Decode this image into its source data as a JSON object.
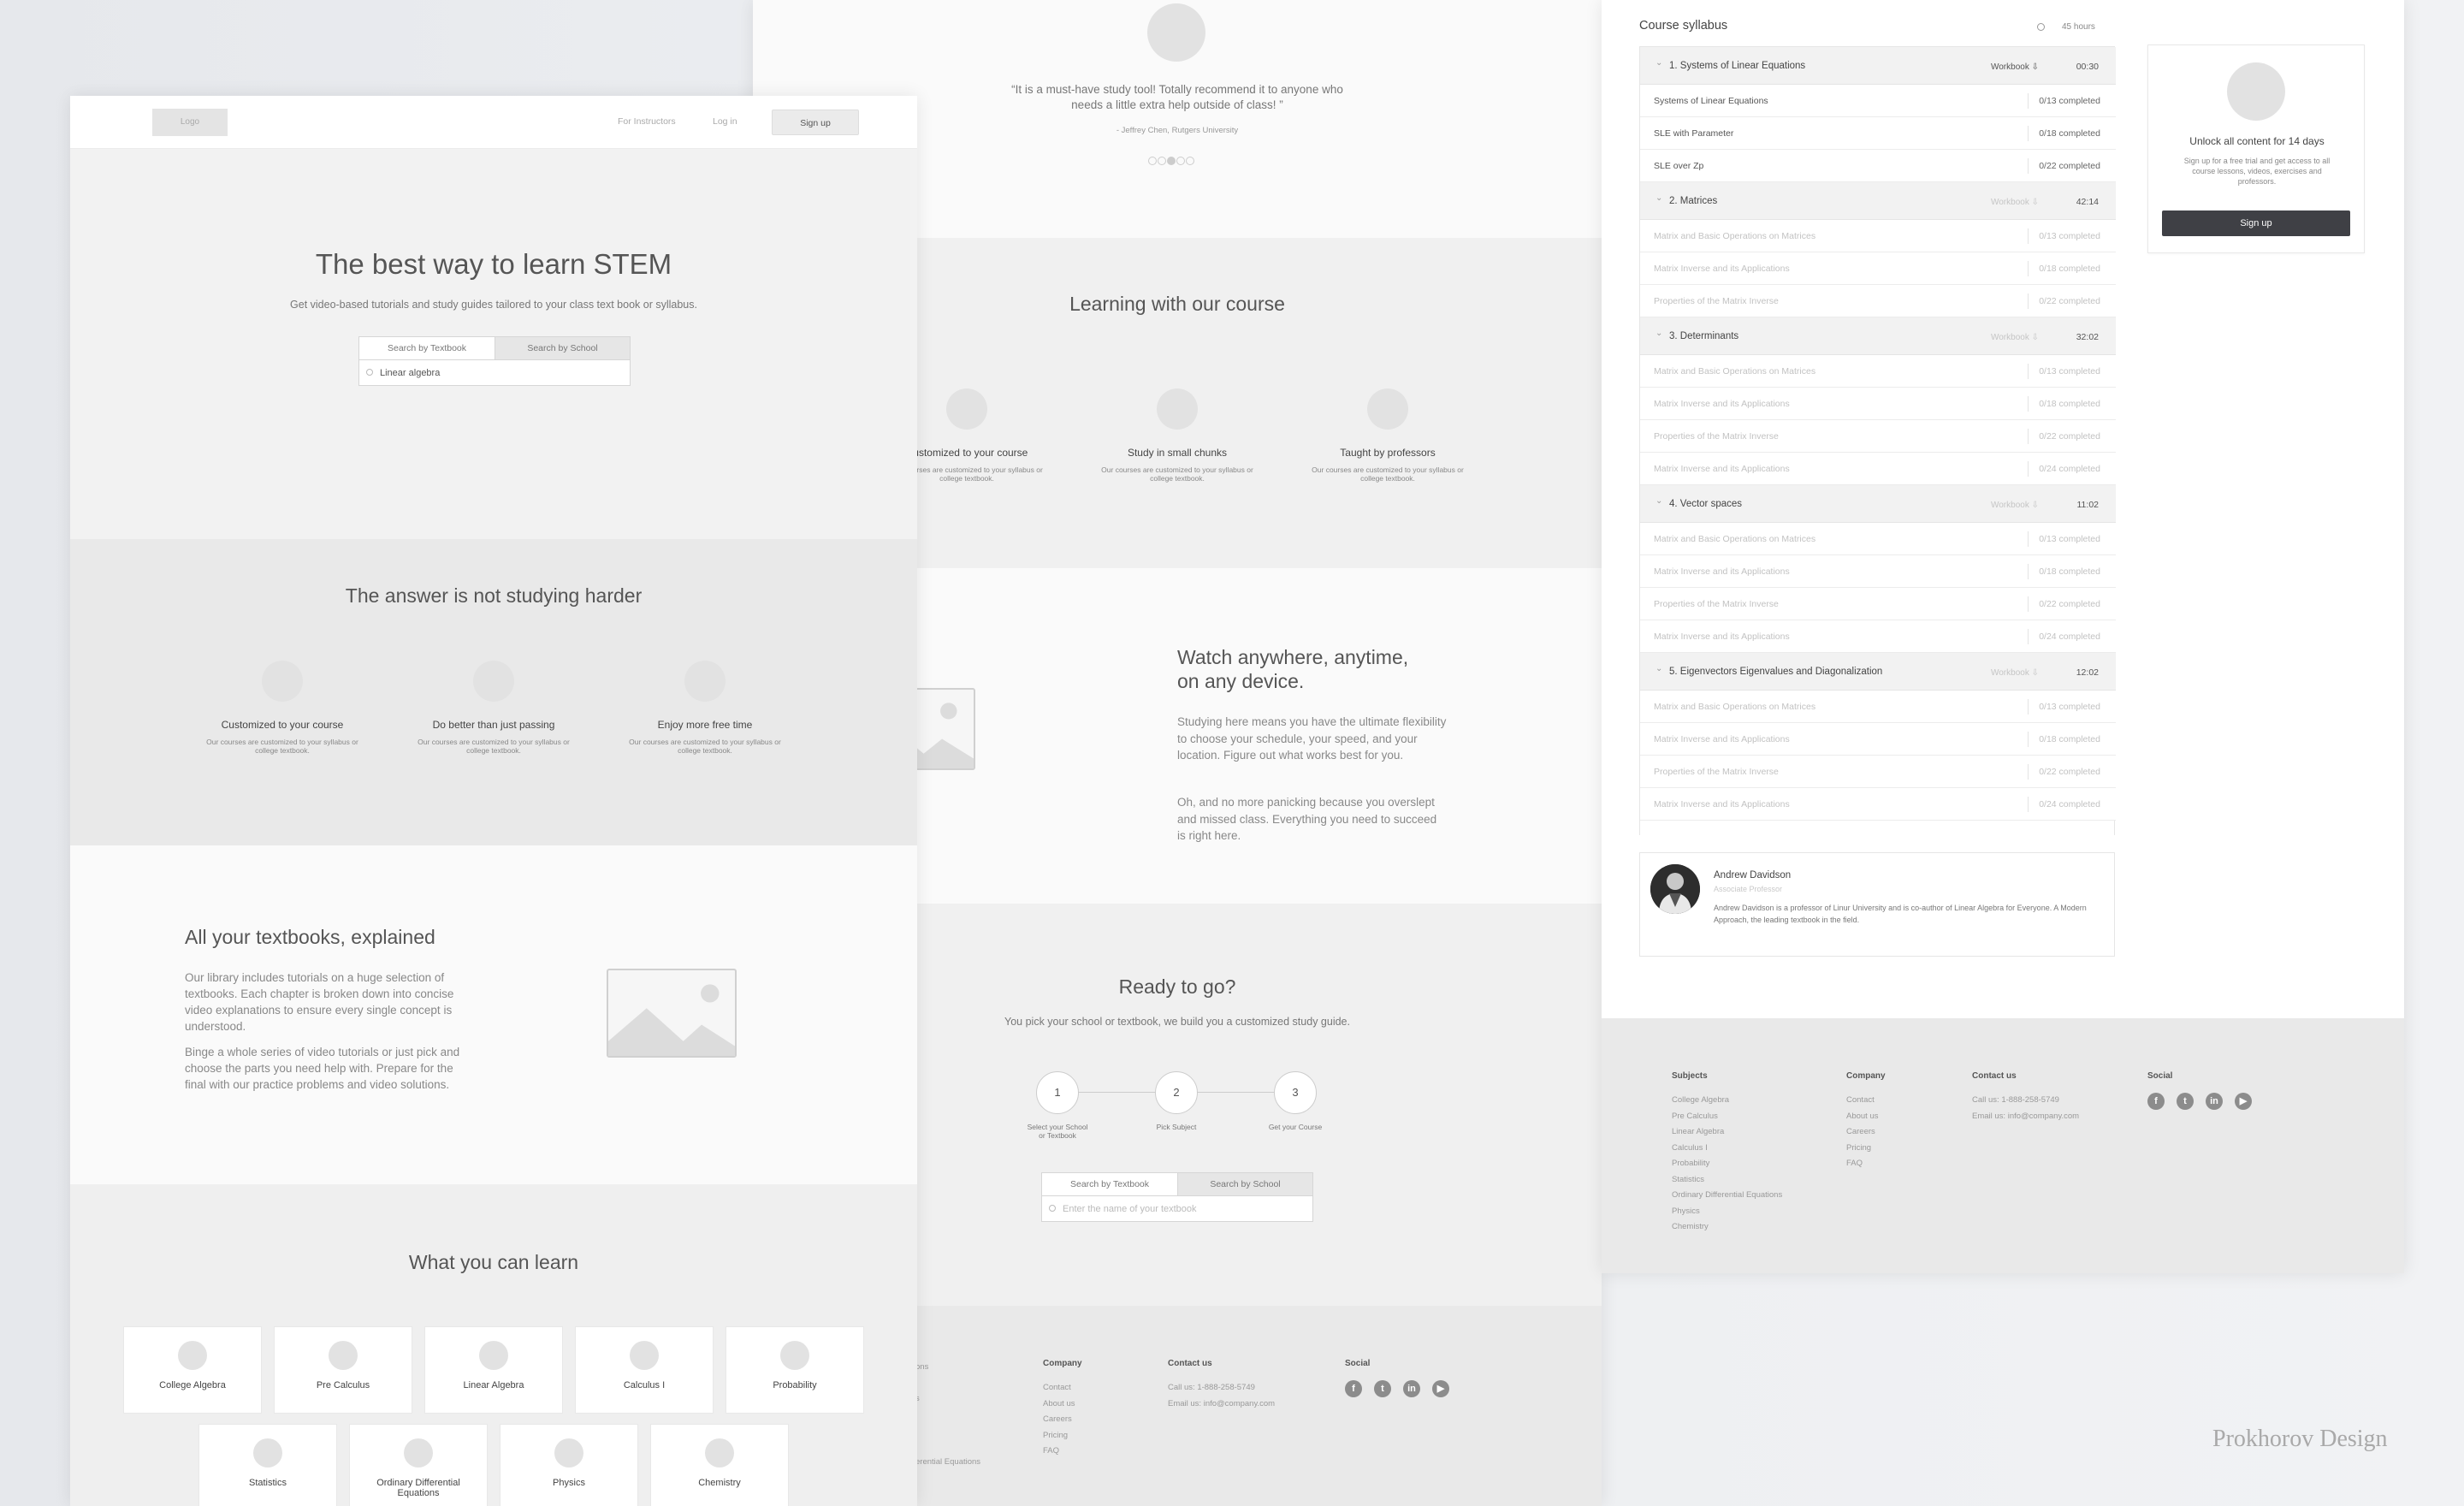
{
  "page1": {
    "nav": {
      "logo": "Logo",
      "for_instructors": "For Instructors",
      "login": "Log in",
      "signup": "Sign up"
    },
    "hero": {
      "title": "The best way to learn STEM",
      "subtitle": "Get video-based tutorials and study guides tailored to your class text book or syllabus.",
      "tab_textbook": "Search by Textbook",
      "tab_school": "Search by School",
      "search_value": "Linear algebra"
    },
    "answer": {
      "title": "The answer is not studying harder",
      "features": [
        {
          "title": "Customized to your course",
          "text": "Our courses are customized to your syllabus or college textbook."
        },
        {
          "title": "Do better than just passing",
          "text": "Our courses are customized to your syllabus or college textbook."
        },
        {
          "title": "Enjoy more free time",
          "text": "Our courses are customized to your syllabus or college textbook."
        }
      ]
    },
    "textbooks": {
      "title": "All your textbooks, explained",
      "p1": "Our library includes tutorials on a huge selection of textbooks. Each chapter is broken down into concise video explanations to ensure every single concept is understood.",
      "p2": "Binge a whole series of video tutorials or just pick and choose the parts you need help with. Prepare for the final with our practice problems and video solutions."
    },
    "learn": {
      "title": "What you can learn",
      "subjects": [
        "College Algebra",
        "Pre Calculus",
        "Linear Algebra",
        "Calculus I",
        "Probability",
        "Statistics",
        "Ordinary Differential Equations",
        "Physics",
        "Chemistry"
      ]
    }
  },
  "page2": {
    "testimonial": {
      "quote": "“It is a must-have study tool! Totally recommend it to anyone who needs a little extra help outside of class! ”",
      "author": "- Jeffrey Chen, Rutgers University"
    },
    "learning": {
      "title": "Learning with our course",
      "features": [
        {
          "title": "Customized to your course",
          "text": "Our courses are customized to your syllabus or college textbook."
        },
        {
          "title": "Study in small chunks",
          "text": "Our courses are customized to your syllabus or college textbook."
        },
        {
          "title": "Taught by professors",
          "text": "Our courses are customized to your syllabus or college textbook."
        }
      ]
    },
    "watch": {
      "title": "Watch anywhere, anytime, on any device.",
      "p1": "Studying here means you have the ultimate flexibility to choose your schedule, your speed, and your location. Figure out what works best for you.",
      "p2": "Oh, and no more panicking because you overslept and missed class. Everything you need to succeed is right here."
    },
    "ready": {
      "title": "Ready to go?",
      "subtitle": "You pick your school or textbook, we build you a customized study guide.",
      "steps": [
        {
          "num": "1",
          "label": "Select your School or Textbook"
        },
        {
          "num": "2",
          "label": "Pick Subject"
        },
        {
          "num": "3",
          "label": "Get your Course"
        }
      ],
      "tab_textbook": "Search by Textbook",
      "tab_school": "Search by School",
      "placeholder": "Enter the name of your textbook"
    },
    "footer": {
      "partial_subjects": [
        "ons",
        "s",
        "erential Equations"
      ],
      "company_title": "Company",
      "company": [
        "Contact",
        "About us",
        "Careers",
        "Pricing",
        "FAQ"
      ],
      "contact_title": "Contact us",
      "phone": "Call us: 1-888-258-5749",
      "email": "Email us: info@company.com",
      "social_title": "Social"
    }
  },
  "page3": {
    "syllabus": {
      "title": "Course syllabus",
      "hours": "45 hours",
      "workbook": "Workbook",
      "modules": [
        {
          "title": "1. Systems of Linear Equations",
          "duration": "00:30",
          "lessons": [
            {
              "name": "Systems of Linear Equations",
              "progress": "0/13 completed"
            },
            {
              "name": "SLE with Parameter",
              "progress": "0/18 completed"
            },
            {
              "name": "SLE over Zp",
              "progress": "0/22 completed"
            }
          ]
        },
        {
          "title": "2. Matrices",
          "duration": "42:14",
          "lessons": [
            {
              "name": "Matrix and Basic Operations on Matrices",
              "progress": "0/13 completed"
            },
            {
              "name": "Matrix Inverse and its Applications",
              "progress": "0/18 completed"
            },
            {
              "name": "Properties of the Matrix Inverse",
              "progress": "0/22 completed"
            }
          ]
        },
        {
          "title": "3. Determinants",
          "duration": "32:02",
          "lessons": [
            {
              "name": "Matrix and Basic Operations on Matrices",
              "progress": "0/13 completed"
            },
            {
              "name": "Matrix Inverse and its Applications",
              "progress": "0/18 completed"
            },
            {
              "name": "Properties of the Matrix Inverse",
              "progress": "0/22 completed"
            },
            {
              "name": "Matrix Inverse and its Applications",
              "progress": "0/24 completed"
            }
          ]
        },
        {
          "title": "4. Vector spaces",
          "duration": "11:02",
          "lessons": [
            {
              "name": "Matrix and Basic Operations on Matrices",
              "progress": "0/13 completed"
            },
            {
              "name": "Matrix Inverse and its Applications",
              "progress": "0/18 completed"
            },
            {
              "name": "Properties of the Matrix Inverse",
              "progress": "0/22 completed"
            },
            {
              "name": "Matrix Inverse and its Applications",
              "progress": "0/24 completed"
            }
          ]
        },
        {
          "title": "5. Eigenvectors Eigenvalues and Diagonalization",
          "duration": "12:02",
          "lessons": [
            {
              "name": "Matrix and Basic Operations on Matrices",
              "progress": "0/13 completed"
            },
            {
              "name": "Matrix Inverse and its Applications",
              "progress": "0/18 completed"
            },
            {
              "name": "Properties of the Matrix Inverse",
              "progress": "0/22 completed"
            },
            {
              "name": "Matrix Inverse and its Applications",
              "progress": "0/24 completed"
            }
          ]
        }
      ]
    },
    "unlock": {
      "title": "Unlock all content for 14 days",
      "text": "Sign up for a free trial and get access to all course lessons, videos, exercises and professors.",
      "button": "Sign up"
    },
    "instructor": {
      "name": "Andrew Davidson",
      "role": "Associate Professor",
      "bio": "Andrew Davidson is a professor of Linur University and is co-author of Linear Algebra for Everyone. A Modern Approach, the leading textbook in the field."
    },
    "footer": {
      "subjects_title": "Subjects",
      "subjects": [
        "College Algebra",
        "Pre Calculus",
        "Linear Algebra",
        "Calculus I",
        "Probability",
        "Statistics",
        "Ordinary Differential Equations",
        "Physics",
        "Chemistry"
      ],
      "company_title": "Company",
      "company": [
        "Contact",
        "About us",
        "Careers",
        "Pricing",
        "FAQ"
      ],
      "contact_title": "Contact us",
      "phone": "Call us: 1-888-258-5749",
      "email": "Email us: info@company.com",
      "social_title": "Social"
    }
  },
  "watermark": "Prokhorov Design",
  "social_icons": [
    "facebook-icon",
    "twitter-icon",
    "linkedin-icon",
    "youtube-icon"
  ]
}
